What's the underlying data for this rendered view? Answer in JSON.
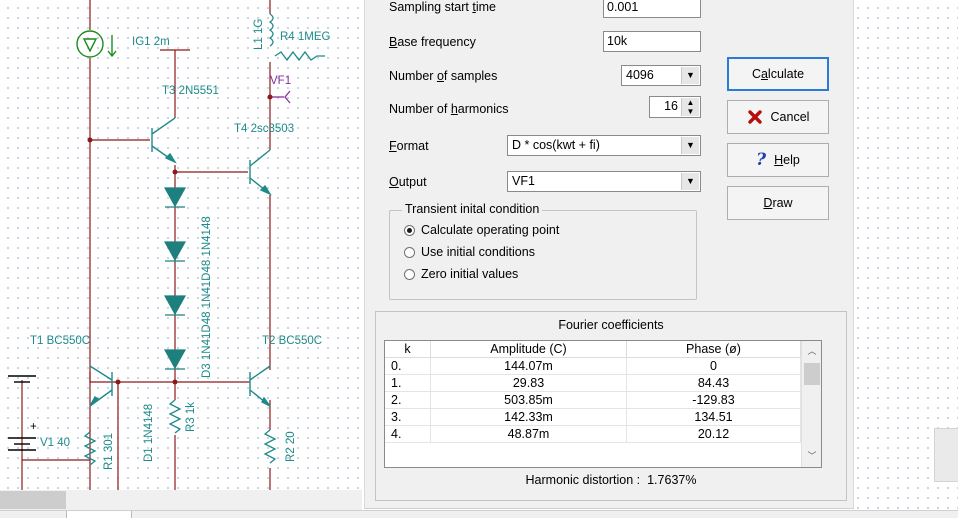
{
  "schematic": {
    "labels": {
      "ig1": "IG1 2m",
      "l1": "L1 1G",
      "r4": "R4 1MEG",
      "vf1": "VF1",
      "t3": "T3 2N5551",
      "t4": "T4 2sc3503",
      "diodes_overlap": "D3 1N41D48 1N41D48 1N4148",
      "t1": "T1 BC550C",
      "t2": "T2 BC550C",
      "d1": "D1 1N4148",
      "r3": "R3 1k",
      "r1": "R1 301",
      "v1": "V1 40",
      "r2": "R2 20"
    },
    "colors": {
      "wire": "#8b1a1a",
      "component": "#1e8a8a",
      "diode_fill": "#1e7f7f",
      "source": "#1b8c1b",
      "meter": "#8a2e9e"
    }
  },
  "dialog": {
    "sampling_start": {
      "label_pre": "Sampling start ",
      "label_u": "t",
      "label_post": "ime",
      "value": "0.001"
    },
    "base_frequency": {
      "label_u": "B",
      "label_post": "ase frequency",
      "value": "10k"
    },
    "num_samples": {
      "label_pre": "Number ",
      "label_u": "o",
      "label_post": "f samples",
      "value": "4096"
    },
    "num_harmonics": {
      "label_pre": "Number of ",
      "label_u": "h",
      "label_post": "armonics",
      "value": "16"
    },
    "format": {
      "label_u": "F",
      "label_post": "ormat",
      "value": "D * cos(kwt + fi)"
    },
    "output": {
      "label_u": "O",
      "label_post": "utput",
      "value": "VF1"
    },
    "transient": {
      "title": "Transient inital condition",
      "options": [
        {
          "label": "Calculate operating point",
          "selected": true
        },
        {
          "label": "Use initial conditions",
          "selected": false
        },
        {
          "label": "Zero initial values",
          "selected": false
        }
      ]
    },
    "buttons": {
      "calculate": {
        "pre": "C",
        "u": "a",
        "post": "lculate"
      },
      "cancel": {
        "label": "Cancel"
      },
      "help": {
        "u": "H",
        "post": "elp"
      },
      "draw": {
        "u": "D",
        "post": "raw"
      }
    },
    "fourier": {
      "title": "Fourier coefficients",
      "columns": [
        "k",
        "Amplitude (C)",
        "Phase (ø)"
      ],
      "rows": [
        [
          "0.",
          "144.07m",
          "0"
        ],
        [
          "1.",
          "29.83",
          "84.43"
        ],
        [
          "2.",
          "503.85m",
          "-129.83"
        ],
        [
          "3.",
          "142.33m",
          "134.51"
        ],
        [
          "4.",
          "48.87m",
          "20.12"
        ]
      ],
      "distortion_label": "Harmonic distortion :",
      "distortion_value": "1.7637%"
    }
  },
  "icons": [
    "cancel-x-icon",
    "help-question-icon",
    "combo-arrow-icon",
    "spin-arrows-icon",
    "scroll-up-icon",
    "scroll-down-icon"
  ]
}
